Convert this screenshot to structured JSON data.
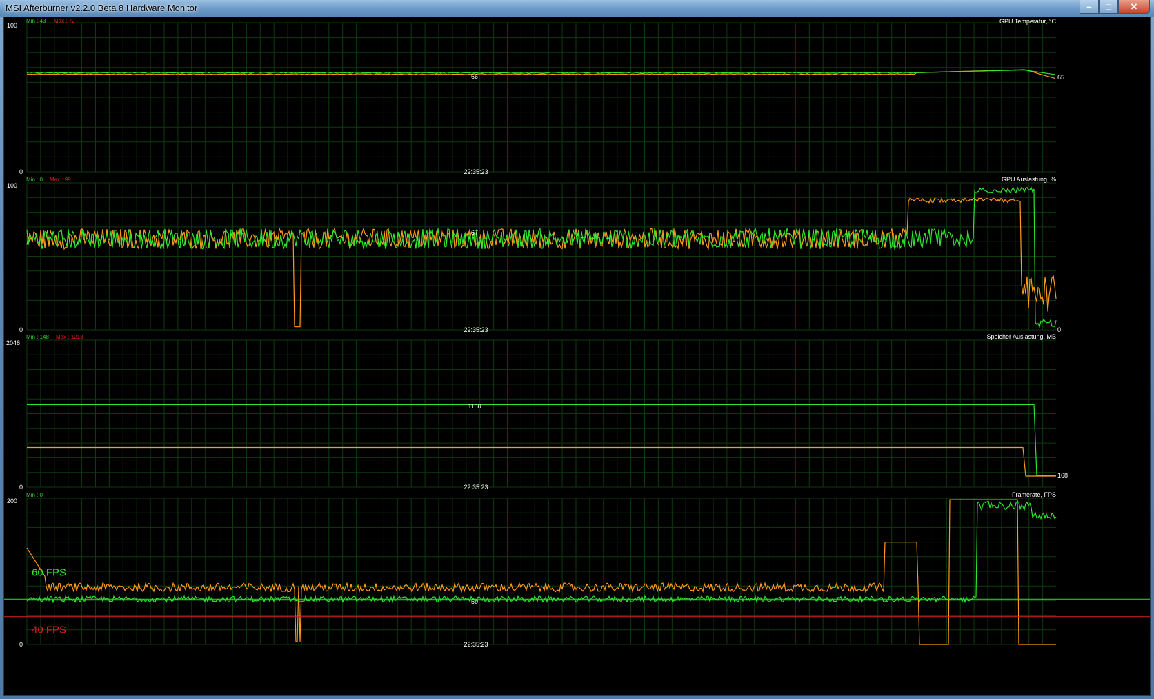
{
  "window": {
    "title": "MSI Afterburner v2.2.0 Beta 8 Hardware Monitor",
    "close_glyph": "✕",
    "min_glyph": "–",
    "max_glyph": "□"
  },
  "colors": {
    "background": "#000000",
    "grid": "#0e3a0e",
    "green_series": "#2ee62e",
    "orange_series": "#ff9a1e",
    "min_label": "#33cc33",
    "max_label": "#dd2222",
    "text": "#ffffff"
  },
  "panels": [
    {
      "name": "GPU Temperatur, °C",
      "min_label": "Min : 43",
      "max_label": "Max : 72",
      "y_top": "100",
      "y_bottom": "0",
      "time": "22:35:23",
      "center_value": "66",
      "end_value": "65",
      "range": [
        0,
        100
      ]
    },
    {
      "name": "GPU Auslastung, %",
      "min_label": "Min : 0",
      "max_label": "Max : 99",
      "y_top": "100",
      "y_bottom": "0",
      "time": "22:35:23",
      "center_value": "67",
      "end_value": "0",
      "range": [
        0,
        100
      ]
    },
    {
      "name": "Speicher Auslastung, MB",
      "min_label": "Min : 148",
      "max_label": "Max : 1213",
      "y_top": "2048",
      "y_bottom": "0",
      "time": "22:35:23",
      "center_value": "1150",
      "end_value": "168",
      "range": [
        0,
        2048
      ]
    },
    {
      "name": "Framerate, FPS",
      "min_label": "Min : 0",
      "max_label": "",
      "y_top": "200",
      "y_bottom": "0",
      "time": "22:35:23",
      "center_value": "50",
      "end_value": "",
      "range": [
        0,
        200
      ]
    }
  ],
  "fps_markers": [
    {
      "label": "60 FPS",
      "value": 60,
      "color": "#2ee62e"
    },
    {
      "label": "40 FPS",
      "value": 40,
      "color": "#dd2222"
    }
  ]
}
